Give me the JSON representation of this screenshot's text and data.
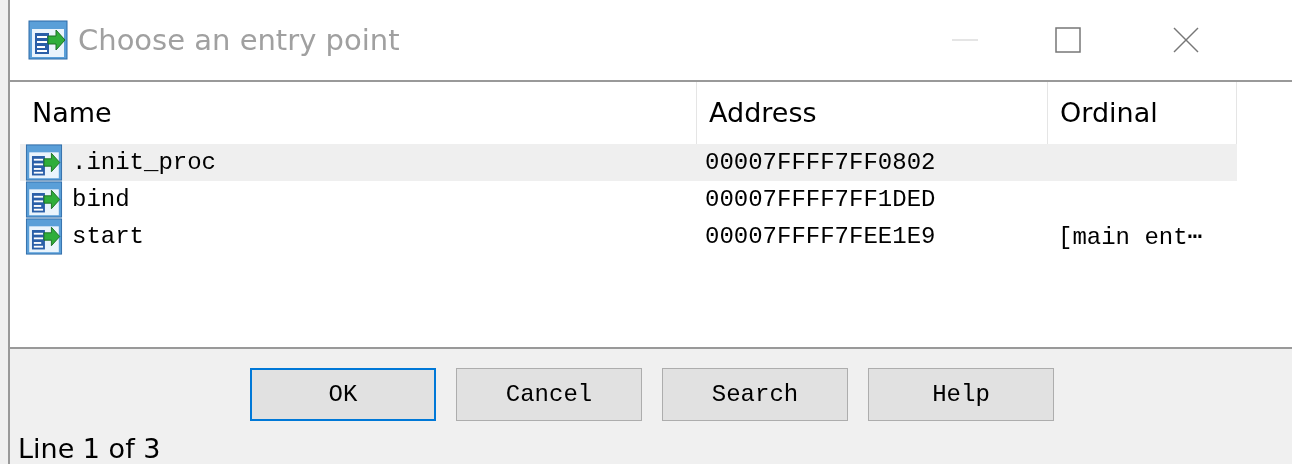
{
  "window": {
    "title": "Choose an entry point"
  },
  "table": {
    "columns": [
      "Name",
      "Address",
      "Ordinal"
    ],
    "rows": [
      {
        "name": ".init_proc",
        "address": "00007FFFF7FF0802",
        "selected": true
      },
      {
        "name": "bind",
        "address": "00007FFFF7FF1DED",
        "selected": false
      },
      {
        "name": "start",
        "address": "00007FFFF7FEE1E9",
        "ordinal": "[main ent⋯",
        "selected": false
      }
    ]
  },
  "buttons": [
    {
      "label": "OK",
      "default": true
    },
    {
      "label": "Cancel",
      "default": false
    },
    {
      "label": "Search",
      "default": false
    },
    {
      "label": "Help",
      "default": false
    }
  ],
  "status_bar": "Line 1 of 3"
}
